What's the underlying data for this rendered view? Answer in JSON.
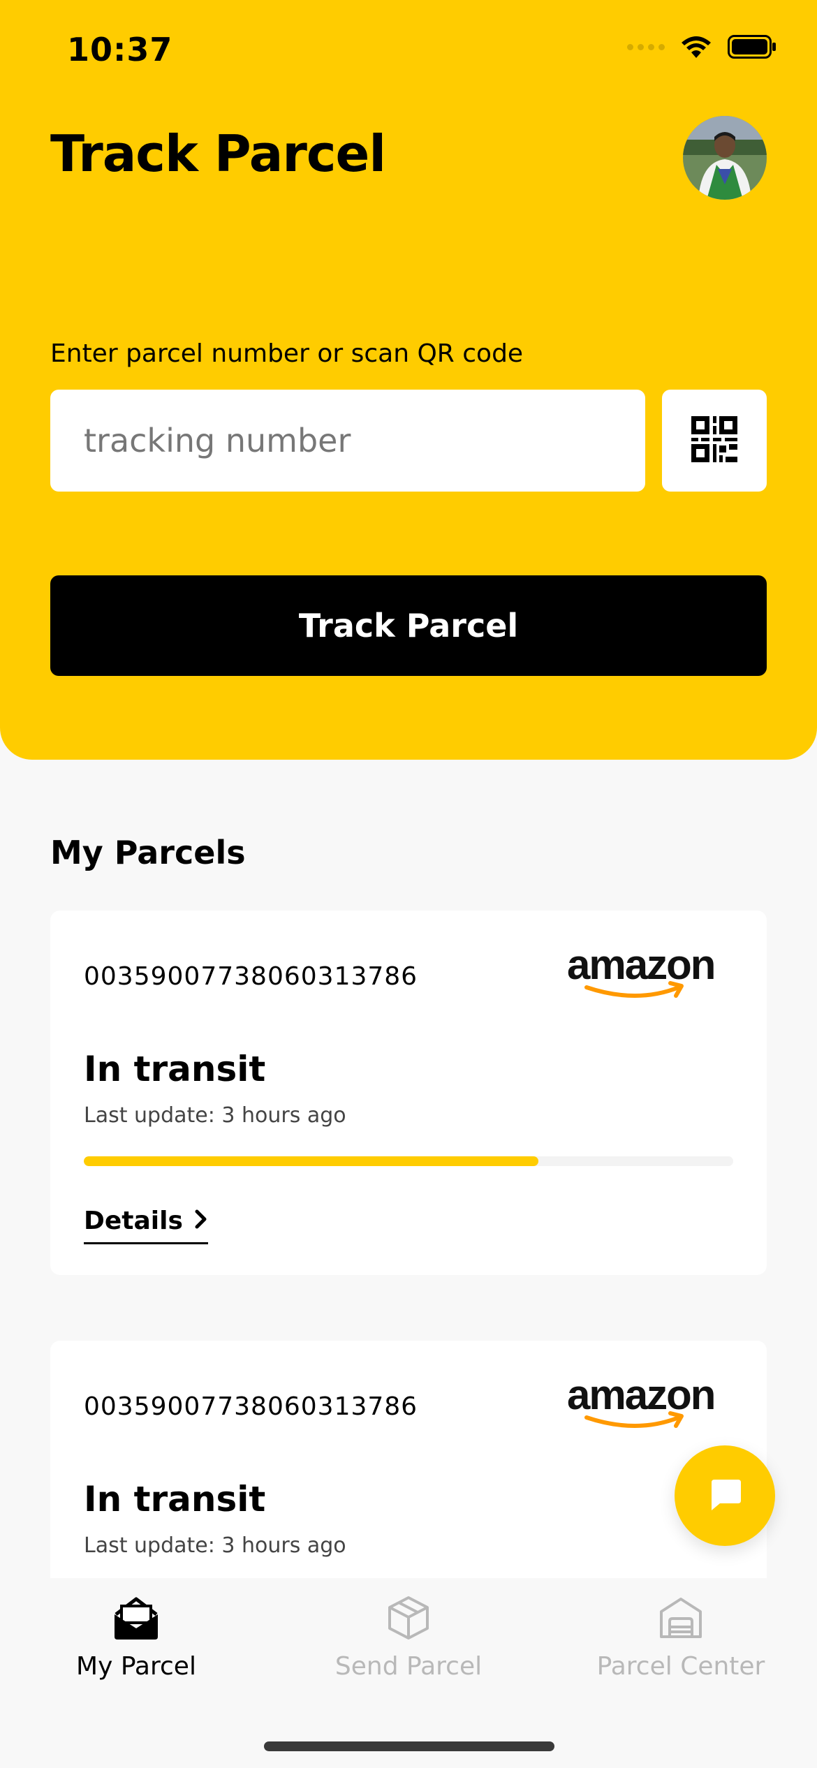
{
  "status_bar": {
    "time": "10:37"
  },
  "header": {
    "title": "Track Parcel",
    "prompt": "Enter parcel number or scan QR code",
    "input_placeholder": "tracking number",
    "input_value": "",
    "track_button_label": "Track Parcel",
    "accent_color": "#FFCC00"
  },
  "my_parcels": {
    "title": "My Parcels",
    "items": [
      {
        "tracking_number": "00359007738060313786",
        "carrier": "amazon",
        "status": "In transit",
        "last_update": "Last update: 3 hours ago",
        "progress": 0.7,
        "details_label": "Details"
      },
      {
        "tracking_number": "00359007738060313786",
        "carrier": "amazon",
        "status": "In transit",
        "last_update": "Last update: 3 hours ago"
      }
    ]
  },
  "bottom_nav": {
    "items": [
      {
        "label": "My Parcel",
        "icon": "open-envelope-icon",
        "active": true
      },
      {
        "label": "Send Parcel",
        "icon": "box-icon",
        "active": false
      },
      {
        "label": "Parcel Center",
        "icon": "warehouse-icon",
        "active": false
      }
    ]
  }
}
